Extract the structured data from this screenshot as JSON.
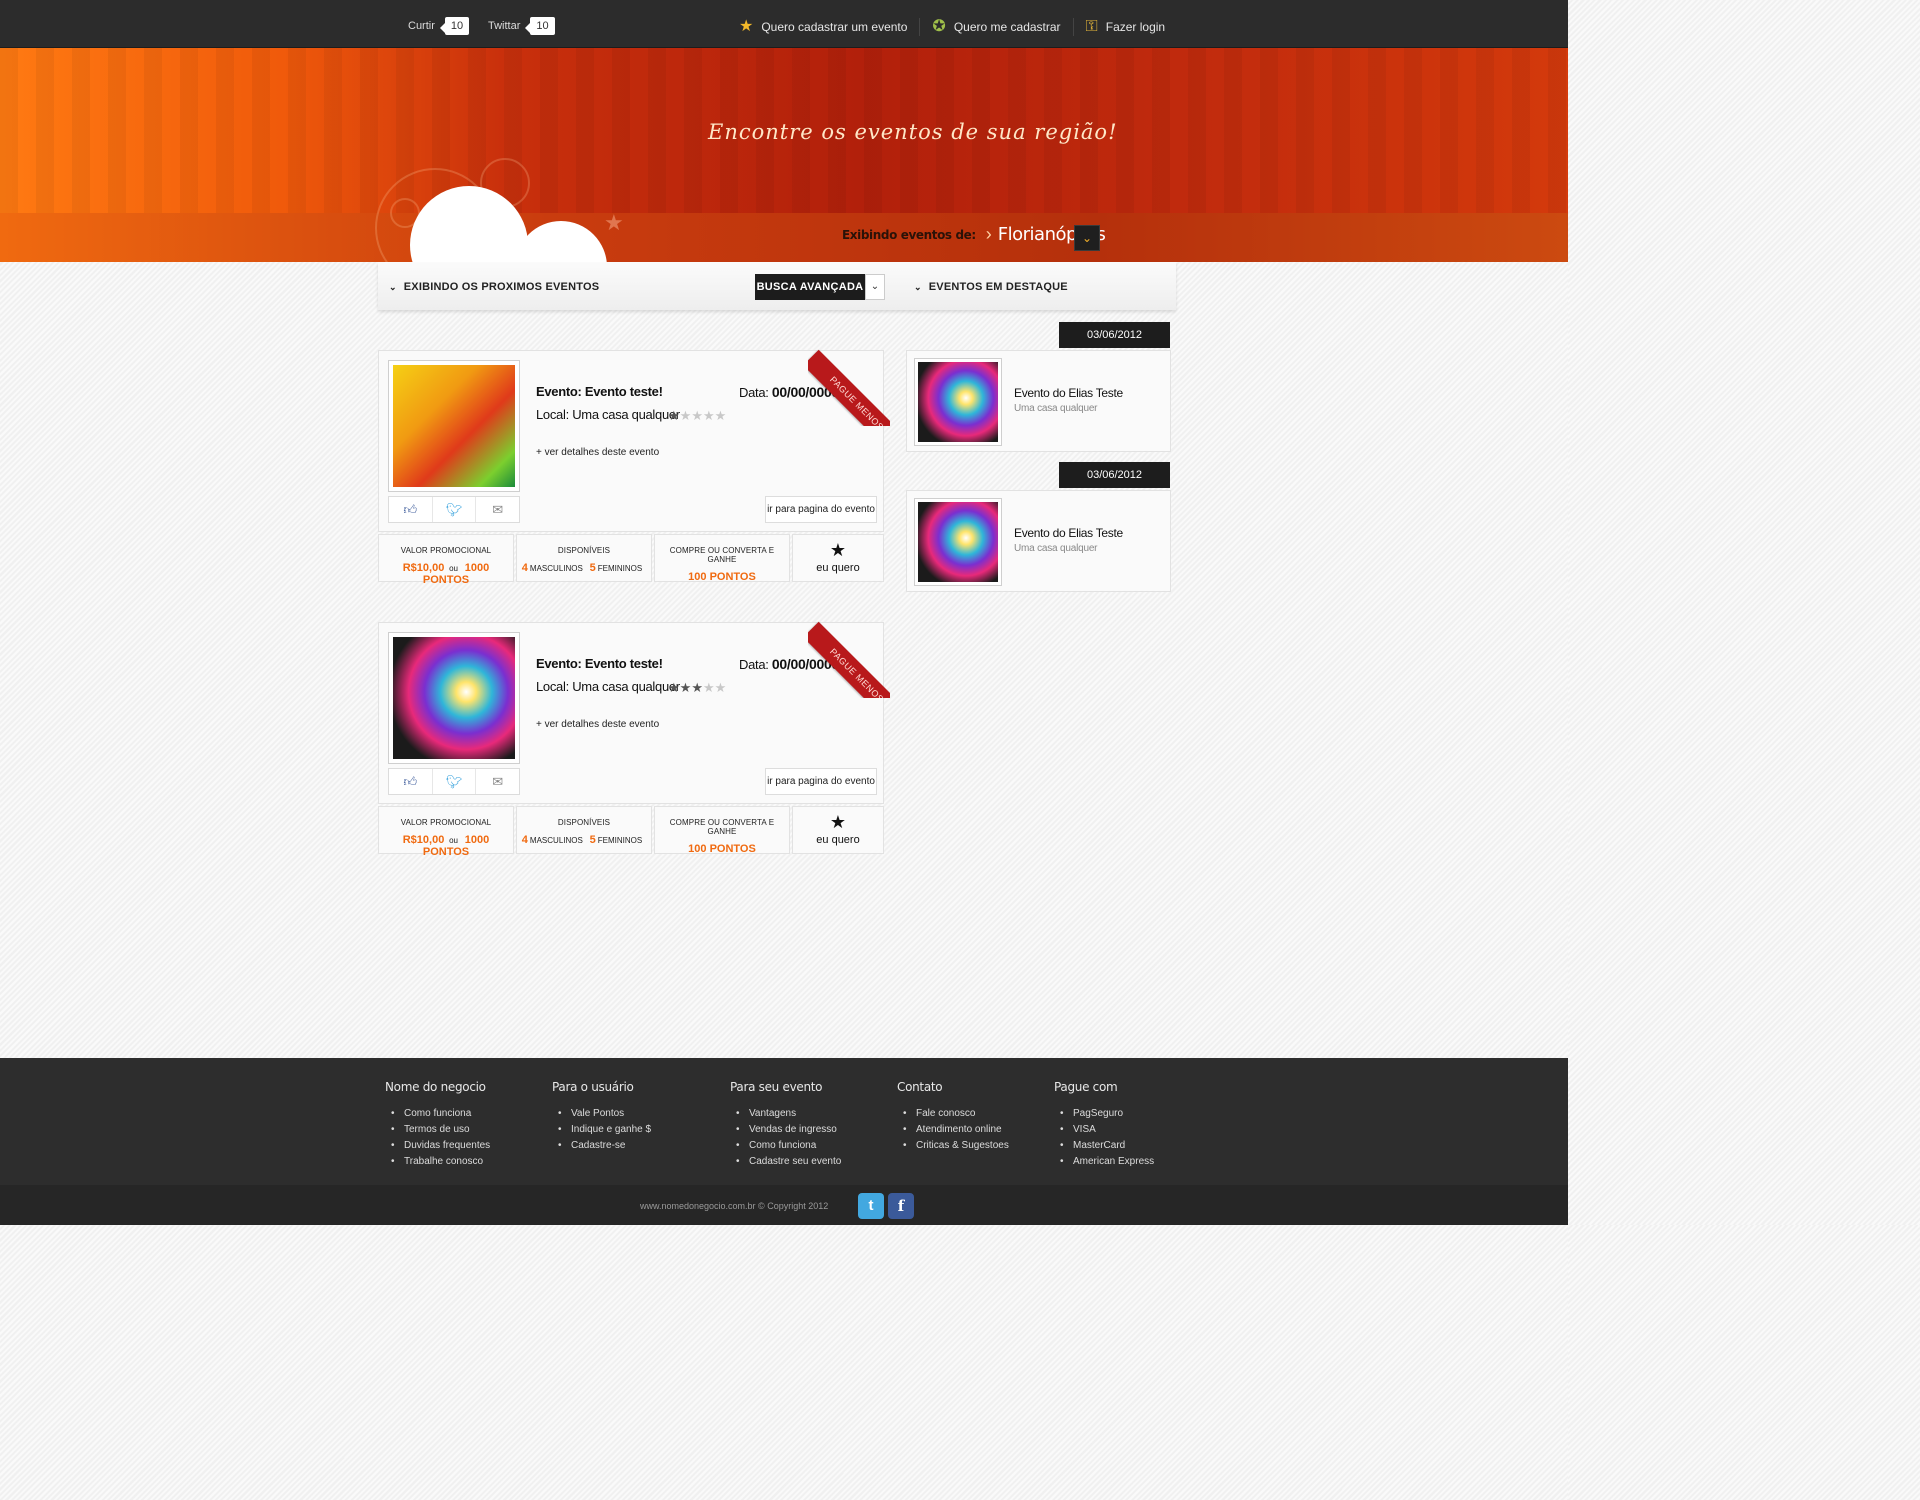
{
  "topbar": {
    "curtir_label": "Curtir",
    "curtir_count": "10",
    "twittar_label": "Twittar",
    "twittar_count": "10",
    "links": [
      "Quero cadastrar um evento",
      "Quero me cadastrar",
      "Fazer login"
    ]
  },
  "hero": {
    "tagline": "Encontre os eventos de sua região!",
    "location_label": "Exibindo eventos de:",
    "location_city": "Florianópolis"
  },
  "sections": {
    "upcoming": "EXIBINDO OS PROXIMOS EVENTOS",
    "search_button": "BUSCA AVANÇADA",
    "featured": "EVENTOS EM DESTAQUE"
  },
  "events": [
    {
      "name": "Evento: Evento teste!",
      "local": "Local: Uma casa qualquer",
      "date_label": "Data:",
      "date": "00/00/0000",
      "rating": 1,
      "rating_max": 5,
      "more": "+ ver detalhes deste evento",
      "goto": "ir para pagina do evento",
      "ribbon": "PAGUE MENOS",
      "promo_caption": "VALOR PROMOCIONAL",
      "price": "R$10,00",
      "or": "ou",
      "points": "1000 PONTOS",
      "avail_caption": "DISPONÍVEIS",
      "male_count": "4",
      "male_label": "MASCULINOS",
      "female_count": "5",
      "female_label": "FEMININOS",
      "earn_caption": "COMPRE OU CONVERTA E GANHE",
      "earn_points": "100 PONTOS",
      "want": "eu quero"
    },
    {
      "name": "Evento: Evento teste!",
      "local": "Local: Uma casa qualquer",
      "date_label": "Data:",
      "date": "00/00/0000",
      "rating": 3,
      "rating_max": 5,
      "more": "+ ver detalhes deste evento",
      "goto": "ir para pagina do evento",
      "ribbon": "PAGUE MENOS",
      "promo_caption": "VALOR PROMOCIONAL",
      "price": "R$10,00",
      "or": "ou",
      "points": "1000 PONTOS",
      "avail_caption": "DISPONÍVEIS",
      "male_count": "4",
      "male_label": "MASCULINOS",
      "female_count": "5",
      "female_label": "FEMININOS",
      "earn_caption": "COMPRE OU CONVERTA E GANHE",
      "earn_points": "100 PONTOS",
      "want": "eu quero"
    }
  ],
  "featured": [
    {
      "date": "03/06/2012",
      "name": "Evento do Elias Teste",
      "local": "Uma casa qualquer"
    },
    {
      "date": "03/06/2012",
      "name": "Evento do Elias Teste",
      "local": "Uma casa qualquer"
    }
  ],
  "footer": {
    "columns": [
      {
        "title": "Nome do negocio",
        "items": [
          "Como funciona",
          "Termos de uso",
          "Duvidas frequentes",
          "Trabalhe conosco"
        ]
      },
      {
        "title": "Para o usuário",
        "items": [
          "Vale Pontos",
          "Indique e ganhe $",
          "Cadastre-se"
        ]
      },
      {
        "title": "Para seu evento",
        "items": [
          "Vantagens",
          "Vendas de ingresso",
          "Como funciona",
          "Cadastre seu evento"
        ]
      },
      {
        "title": "Contato",
        "items": [
          "Fale conosco",
          "Atendimento online",
          "Criticas & Sugestoes"
        ]
      },
      {
        "title": "Pague com",
        "items": [
          "PagSeguro",
          "VISA",
          "MasterCard",
          "American Express"
        ]
      }
    ],
    "copyright": "www.nomedonegocio.com.br © Copyright 2012"
  },
  "colors": {
    "accent": "#f06a10",
    "ribbon": "#b8191b",
    "dark": "#2c2c2c"
  }
}
